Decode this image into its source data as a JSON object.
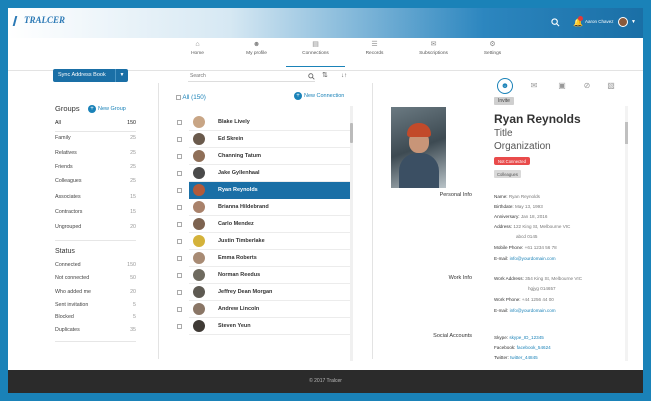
{
  "app": {
    "logo": "TRALCER"
  },
  "topbar": {
    "user_name": "Aaron Chavez"
  },
  "nav": [
    {
      "label": "Home",
      "icon": "home-icon"
    },
    {
      "label": "My profile",
      "icon": "user-icon"
    },
    {
      "label": "Connections",
      "icon": "id-card-icon"
    },
    {
      "label": "Records",
      "icon": "document-icon"
    },
    {
      "label": "Subscriptions",
      "icon": "mail-icon"
    },
    {
      "label": "Settings",
      "icon": "gear-icon"
    }
  ],
  "sidebar": {
    "sync_label": "Sync Address Book",
    "groups_title": "Groups",
    "new_group_label": "New Group",
    "groups": [
      {
        "label": "All",
        "count": "150"
      },
      {
        "label": "Family",
        "count": "25"
      },
      {
        "label": "Relatives",
        "count": "25"
      },
      {
        "label": "Friends",
        "count": "25"
      },
      {
        "label": "Colleagues",
        "count": "25"
      },
      {
        "label": "Associates",
        "count": "15"
      },
      {
        "label": "Contractors",
        "count": "15"
      },
      {
        "label": "Ungrouped",
        "count": "20"
      }
    ],
    "status_title": "Status",
    "statuses": [
      {
        "label": "Connected",
        "count": "150"
      },
      {
        "label": "Not connected",
        "count": "50"
      },
      {
        "label": "Who added me",
        "count": "20"
      },
      {
        "label": "Sent invitation",
        "count": "5"
      },
      {
        "label": "Blocked",
        "count": "5"
      },
      {
        "label": "Duplicates",
        "count": "35"
      }
    ]
  },
  "contacts": {
    "search_placeholder": "Search",
    "all_label": "All",
    "all_count": "(150)",
    "new_connection_label": "New Connection",
    "items": [
      {
        "name": "Blake Lively"
      },
      {
        "name": "Ed Skrein"
      },
      {
        "name": "Channing Tatum"
      },
      {
        "name": "Jake Gyllenhaal"
      },
      {
        "name": "Ryan Reynolds"
      },
      {
        "name": "Brianna Hildebrand"
      },
      {
        "name": "Carlo Mendez"
      },
      {
        "name": "Justin Timberlake"
      },
      {
        "name": "Emma Roberts"
      },
      {
        "name": "Norman Reedus"
      },
      {
        "name": "Jeffrey Dean Morgan"
      },
      {
        "name": "Andrew Lincoln"
      },
      {
        "name": "Steven Yeun"
      }
    ]
  },
  "profile": {
    "invite_label": "Invite",
    "name": "Ryan Reynolds",
    "title": "Title",
    "organization": "Organization",
    "status_badge": "Not Connected",
    "group_badge": "Colleagues",
    "personal_info_title": "Personal Info",
    "work_info_title": "Work Info",
    "social_title": "Social Accounts",
    "personal": {
      "name_label": "Name:",
      "name_value": "Ryan Reynolds",
      "birth_label": "Birthdate:",
      "birth_value": "May 13, 1993",
      "anniv_label": "Anniversary:",
      "anniv_value": "Jan 18, 2016",
      "addr_label": "Address:",
      "addr_value": "122 King St, Melbourne VIC",
      "addr_value2": "abcd 0145",
      "phone_label": "Mobile Phone:",
      "phone_value": "+61 1234 56 78",
      "email_label": "E-mail:",
      "email_value": "info@yourdomain.com"
    },
    "work": {
      "addr_label": "Work Address:",
      "addr_value": "354 King St, Melbourne VIC",
      "addr_value2": "hgjyg 014657",
      "phone_label": "Work Phone:",
      "phone_value": "+44 1256 44 00",
      "email_label": "E-mail:",
      "email_value": "info@yourdomain.com"
    },
    "social": {
      "skype_label": "Skype:",
      "skype_value": "skype_ID_12345",
      "facebook_label": "Facebook:",
      "facebook_value": "facebook_54624",
      "twitter_label": "Twitter:",
      "twitter_value": "twitter_44845"
    }
  },
  "footer": {
    "copyright": "© 2017 Tralcer"
  },
  "colors": {
    "accent": "#1a82b8",
    "selected_row": "#1a6fa6",
    "badge_red": "#e94b4b",
    "footer": "#2b2b2b"
  }
}
